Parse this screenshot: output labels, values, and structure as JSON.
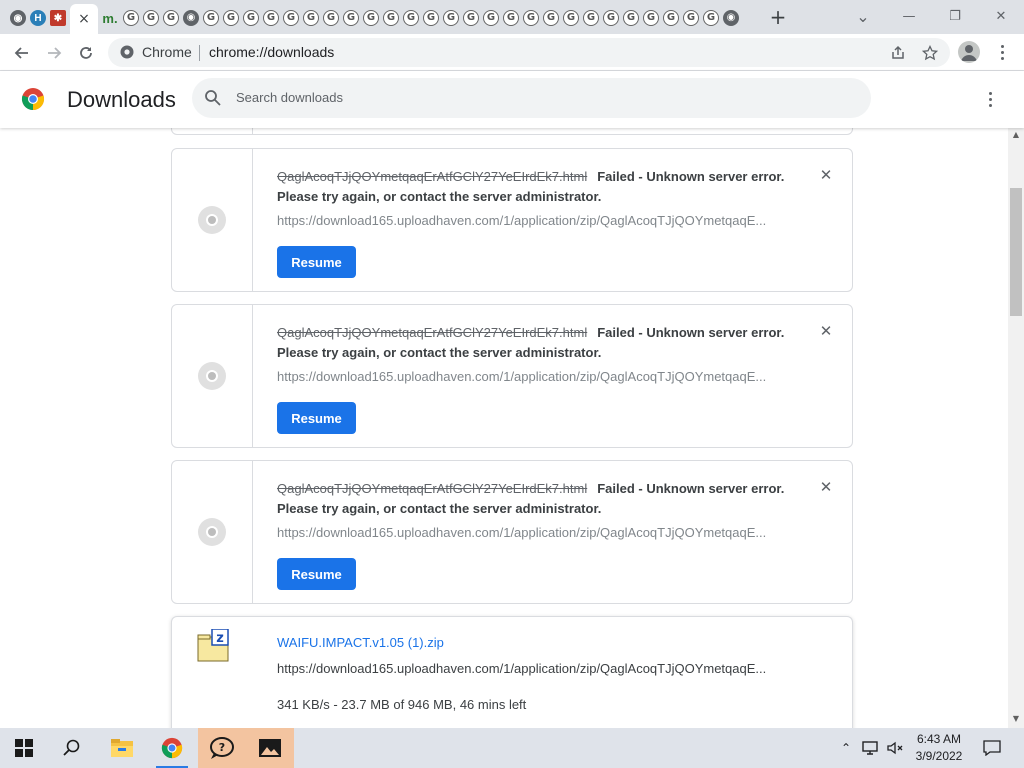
{
  "browser": {
    "tabs_extra_count_g": 31,
    "active_tab_close": "×",
    "new_tab": "+",
    "window_controls": {
      "minimize": "—",
      "restore": "❐",
      "close": "✕"
    },
    "tab_dropdown": "⌄"
  },
  "omnibox": {
    "chip_label": "Chrome",
    "url": "chrome://downloads"
  },
  "page": {
    "title": "Downloads",
    "search_placeholder": "Search downloads"
  },
  "downloads": {
    "failed_items": [
      {
        "filename": "QaglAcoqTJjQOYmetqaqErAtfGClY27YeEIrdEk7.html",
        "status": "Failed - Unknown server error.",
        "status_detail": "Please try again, or contact the server administrator.",
        "url": "https://download165.uploadhaven.com/1/application/zip/QaglAcoqTJjQOYmetqaqE...",
        "action": "Resume"
      },
      {
        "filename": "QaglAcoqTJjQOYmetqaqErAtfGClY27YeEIrdEk7.html",
        "status": "Failed - Unknown server error.",
        "status_detail": "Please try again, or contact the server administrator.",
        "url": "https://download165.uploadhaven.com/1/application/zip/QaglAcoqTJjQOYmetqaqE...",
        "action": "Resume"
      },
      {
        "filename": "QaglAcoqTJjQOYmetqaqErAtfGClY27YeEIrdEk7.html",
        "status": "Failed - Unknown server error.",
        "status_detail": "Please try again, or contact the server administrator.",
        "url": "https://download165.uploadhaven.com/1/application/zip/QaglAcoqTJjQOYmetqaqE...",
        "action": "Resume"
      }
    ],
    "active_item": {
      "filename": "WAIFU.IMPACT.v1.05 (1).zip",
      "url": "https://download165.uploadhaven.com/1/application/zip/QaglAcoqTJjQOYmetqaqE...",
      "progress": "341 KB/s - 23.7 MB of 946 MB, 46 mins left"
    }
  },
  "taskbar": {
    "time": "6:43 AM",
    "date": "3/9/2022"
  },
  "colors": {
    "accent": "#1a73e8",
    "tabstrip": "#dee1e6",
    "taskbar": "#dfe3ea"
  }
}
